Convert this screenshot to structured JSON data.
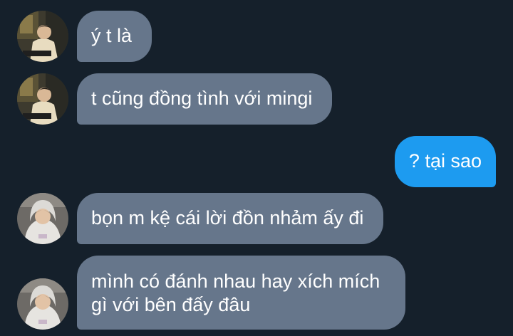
{
  "messages": [
    {
      "side": "received",
      "text": "ý t là",
      "avatar": "avatar-man-keyboard"
    },
    {
      "side": "received",
      "text": "t cũng đồng tình với mingi",
      "avatar": "avatar-man-keyboard"
    },
    {
      "side": "sent",
      "text": "? tại sao"
    },
    {
      "side": "received",
      "text": "bọn m kệ cái lời đồn nhảm ấy đi",
      "avatar": "avatar-hoodie-person"
    },
    {
      "side": "received",
      "lines": [
        "mình có đánh nhau hay xích mích",
        "gì với bên đấy đâu"
      ],
      "avatar": "avatar-hoodie-person"
    }
  ],
  "colors": {
    "background": "#15202b",
    "received_bubble": "#66768b",
    "sent_bubble": "#1d9bf0",
    "text": "#ffffff"
  }
}
